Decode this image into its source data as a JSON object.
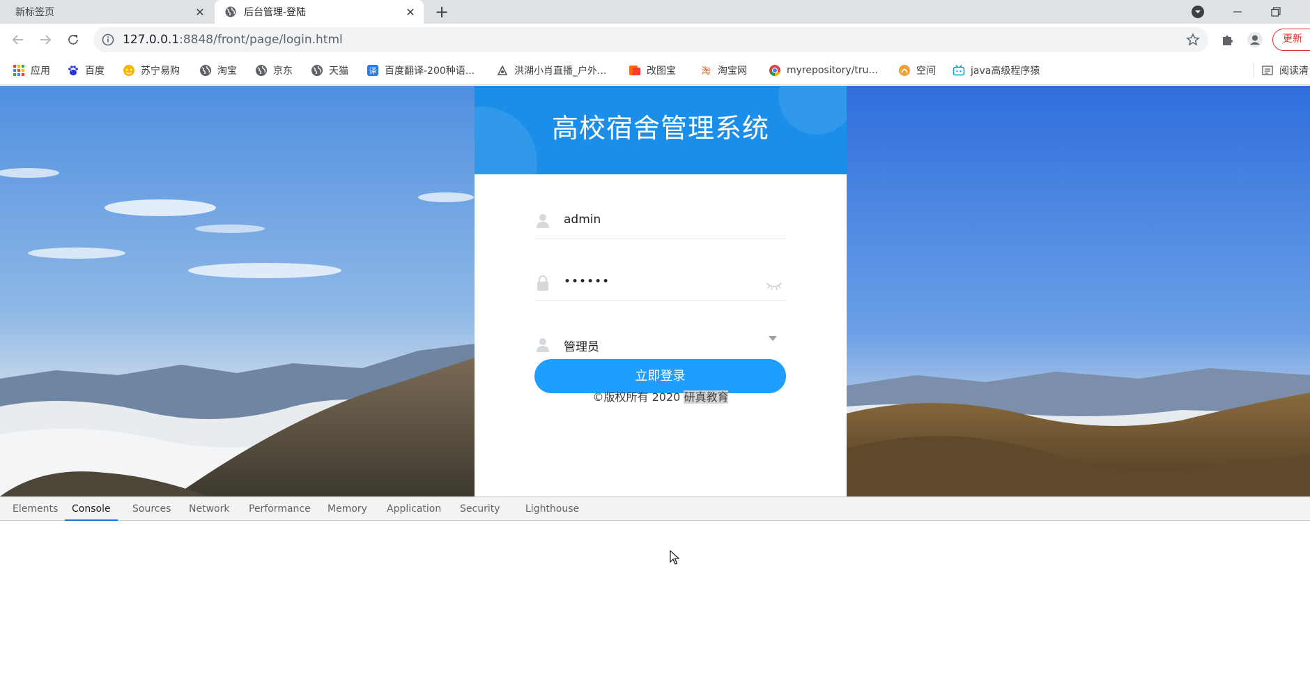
{
  "browser": {
    "tabs": [
      {
        "title": "新标签页",
        "active": false
      },
      {
        "title": "后台管理-登陆",
        "active": true
      }
    ],
    "url_host": "127.0.0.1",
    "url_path": ":8848/front/page/login.html",
    "update_label": "更新"
  },
  "bookmarks": [
    {
      "label": "应用",
      "icon": "apps-grid-icon"
    },
    {
      "label": "百度",
      "icon": "baidu-paw-icon"
    },
    {
      "label": "苏宁易购",
      "icon": "suning-icon"
    },
    {
      "label": "淘宝",
      "icon": "globe-icon"
    },
    {
      "label": "京东",
      "icon": "globe-icon"
    },
    {
      "label": "天猫",
      "icon": "globe-icon"
    },
    {
      "label": "百度翻译-200种语...",
      "icon": "translate-icon"
    },
    {
      "label": "洪湖小肖直播_户外...",
      "icon": "live-icon"
    },
    {
      "label": "改图宝",
      "icon": "image-edit-icon"
    },
    {
      "label": "淘宝网",
      "icon": "taobao-icon"
    },
    {
      "label": "myrepository/tru...",
      "icon": "chrome-icon"
    },
    {
      "label": "空间",
      "icon": "qzone-icon"
    },
    {
      "label": "java高级程序猿",
      "icon": "bilibili-icon"
    },
    {
      "label": "阅读清",
      "icon": "reading-list-icon"
    }
  ],
  "login": {
    "title": "高校宿舍管理系统",
    "username": "admin",
    "password_mask": "••••••",
    "role": "管理员",
    "submit_label": "立即登录",
    "copyright_prefix": "©版权所有 2020 ",
    "copyright_highlight": "研真教育"
  },
  "devtools": {
    "tabs": [
      "Elements",
      "Console",
      "Sources",
      "Network",
      "Performance",
      "Memory",
      "Application",
      "Security",
      "Lighthouse"
    ],
    "active_tab": "Console"
  },
  "colors": {
    "header_blue": "#1a8ee8",
    "button_blue": "#1e9fff",
    "update_red": "#d93025"
  }
}
